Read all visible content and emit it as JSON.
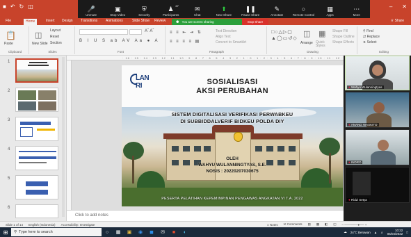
{
  "colors": {
    "ribbon_accent": "#c8432b",
    "zoom_bar": "#1a1a1a",
    "share_green": "#2b9f3b",
    "stop_red": "#d9312b",
    "taskbar": "#1b2a3b"
  },
  "zoom_toolbar": {
    "items": [
      {
        "label": "Unmute",
        "icon": "microphone-icon"
      },
      {
        "label": "Stop Video",
        "icon": "video-camera-icon"
      },
      {
        "label": "Security",
        "icon": "shield-icon"
      },
      {
        "label": "Participants",
        "icon": "participants-icon",
        "count": "27"
      },
      {
        "label": "Chat",
        "icon": "chat-icon"
      },
      {
        "label": "New Share",
        "icon": "share-screen-icon"
      },
      {
        "label": "Pause Share",
        "icon": "pause-icon"
      },
      {
        "label": "Annotate",
        "icon": "pencil-icon"
      },
      {
        "label": "Remote Control",
        "icon": "remote-control-icon"
      },
      {
        "label": "Apps",
        "icon": "apps-icon"
      },
      {
        "label": "More",
        "icon": "more-icon"
      }
    ],
    "share_banner": "You are screen sharing",
    "stop_share": "Stop Share"
  },
  "ribbon": {
    "tabs": [
      "File",
      "Home",
      "Insert",
      "Design",
      "Transitions",
      "Animations",
      "Slide Show",
      "Review",
      "View"
    ],
    "active_tab": "Home",
    "share_label": "Share",
    "groups": {
      "clipboard": "Clipboard",
      "slides": "Slides",
      "font": "Font",
      "paragraph": "Paragraph",
      "drawing": "Drawing",
      "editing": "Editing"
    },
    "buttons": {
      "paste": "Paste",
      "new_slide": "New Slide",
      "layout": "Layout",
      "reset": "Reset",
      "section": "Section",
      "text_direction": "Text Direction",
      "align_text": "Align Text",
      "convert_smartart": "Convert to SmartArt",
      "arrange": "Arrange",
      "quick_styles": "Quick Styles",
      "shape_fill": "Shape Fill",
      "shape_outline": "Shape Outline",
      "shape_effects": "Shape Effects",
      "find": "Find",
      "replace": "Replace",
      "select": "Select"
    }
  },
  "thumbnails": [
    {
      "num": "1",
      "selected": true
    },
    {
      "num": "2",
      "selected": false
    },
    {
      "num": "3",
      "selected": false
    },
    {
      "num": "4",
      "selected": false
    },
    {
      "num": "5",
      "selected": false
    },
    {
      "num": "6",
      "selected": false
    }
  ],
  "slide": {
    "logo_text": "LAN RI",
    "title_line1": "SOSIALISASI",
    "title_line2": "AKSI PERUBAHAN",
    "subtitle_line1": "SISTEM DIGITALISASI VERIFIKASI PERWABKEU",
    "subtitle_line2": "DI SUBBIDDALVERIF BIDKEU POLDA DIY",
    "oleh": "OLEH",
    "author": "WAHYU WULANNINGTYAS, S.E.",
    "nosis": "NOSIS : 20220207030675",
    "footer": "PESERTA PELATIHAN KEPEMIMPINAN PENGAWAS ANGKATAN VI T.A. 2022"
  },
  "notes": {
    "placeholder": "Click to add notes"
  },
  "participants": [
    {
      "name": "Wahyu Wulanningtyas"
    },
    {
      "name": "ANANG WASKITO"
    },
    {
      "name": "INDRO"
    },
    {
      "name": "Ridzi Setya"
    }
  ],
  "statusbar": {
    "slide_of": "Slide 1 of 14",
    "language": "English (Indonesia)",
    "accessibility": "Accessibility: Investigate",
    "notes": "Notes",
    "comments": "Comments"
  },
  "taskbar": {
    "search_placeholder": "Type here to search",
    "weather": "24°C Berawan",
    "time": "10:22",
    "date": "05/04/2022"
  }
}
